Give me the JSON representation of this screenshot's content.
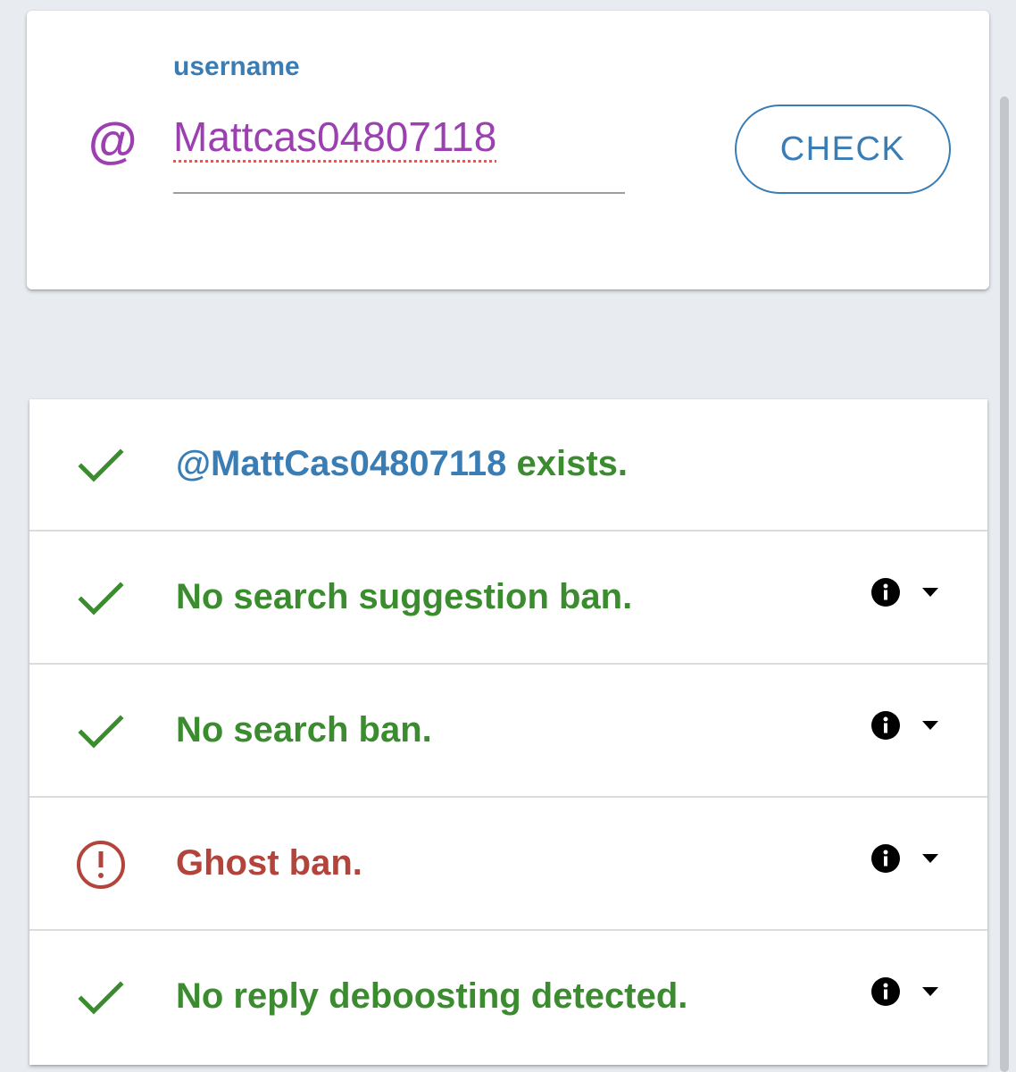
{
  "search": {
    "label": "username",
    "at_symbol": "@",
    "value": "Mattcas04807118",
    "check_label": "CHECK"
  },
  "results": [
    {
      "status": "ok",
      "icon": "check-icon",
      "handle": "@MattCas04807118",
      "text": " exists.",
      "has_details": false
    },
    {
      "status": "ok",
      "icon": "check-icon",
      "text": "No search suggestion ban.",
      "has_details": true
    },
    {
      "status": "ok",
      "icon": "check-icon",
      "text": "No search ban.",
      "has_details": true
    },
    {
      "status": "bad",
      "icon": "alert-circle-icon",
      "text": "Ghost ban.",
      "has_details": true
    },
    {
      "status": "ok",
      "icon": "check-icon",
      "text": "No reply deboosting detected.",
      "has_details": true
    }
  ],
  "colors": {
    "accent_blue": "#3a7db5",
    "username_purple": "#9c3fb0",
    "ok_green": "#3a8c2e",
    "bad_red": "#b3443c",
    "background": "#e8ecf0"
  }
}
